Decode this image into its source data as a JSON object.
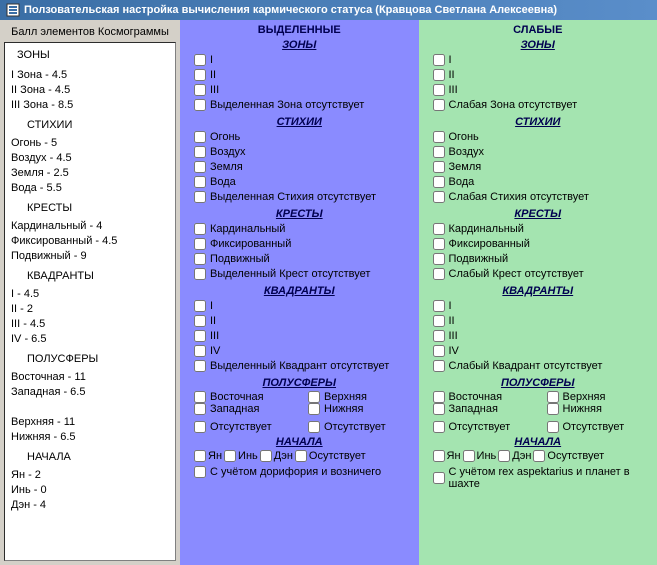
{
  "window": {
    "title": "Ползовательская настройка вычисления кармического статуса (Кравцова Светлана Алексеевна)"
  },
  "left": {
    "header": "Балл элементов Космограммы",
    "top_item": "ЗОНЫ",
    "groups": [
      {
        "title": "",
        "items": [
          "I Зона - 4.5",
          "II Зона - 4.5",
          "III Зона - 8.5"
        ]
      },
      {
        "title": "СТИХИИ",
        "items": [
          "Огонь - 5",
          "Воздух - 4.5",
          "Земля - 2.5",
          "Вода - 5.5"
        ]
      },
      {
        "title": "КРЕСТЫ",
        "items": [
          "Кардинальный - 4",
          "Фиксированный - 4.5",
          "Подвижный - 9"
        ]
      },
      {
        "title": "КВАДРАНТЫ",
        "items": [
          "I - 4.5",
          "II - 2",
          "III - 4.5",
          "IV - 6.5"
        ]
      },
      {
        "title": "ПОЛУСФЕРЫ",
        "items": [
          "Восточная - 11",
          "Западная - 6.5",
          "",
          "Верхняя - 11",
          "Нижняя - 6.5"
        ]
      },
      {
        "title": "НАЧАЛА",
        "items": [
          "Ян - 2",
          "Инь - 0",
          "Дэн - 4"
        ]
      }
    ]
  },
  "panes": {
    "highlighted": {
      "title": "ВЫДЕЛЕННЫЕ",
      "zones": {
        "head": "ЗОНЫ",
        "items": [
          "I",
          "II",
          "III"
        ],
        "absent": "Выделенная Зона отсутствует"
      },
      "elements": {
        "head": "СТИХИИ",
        "items": [
          "Огонь",
          "Воздух",
          "Земля",
          "Вода"
        ],
        "absent": "Выделенная Стихия отсутствует"
      },
      "crosses": {
        "head": "КРЕСТЫ",
        "items": [
          "Кардинальный",
          "Фиксированный",
          "Подвижный"
        ],
        "absent": "Выделенный Крест отсутствует"
      },
      "quadrants": {
        "head": "КВАДРАНТЫ",
        "items": [
          "I",
          "II",
          "III",
          "IV"
        ],
        "absent": "Выделенный Квадрант отсутствует"
      },
      "hemis": {
        "head": "ПОЛУСФЕРЫ",
        "east": "Восточная",
        "west": "Западная",
        "top": "Верхняя",
        "bot": "Нижняя",
        "abs1": "Отсутствует",
        "abs2": "Отсутствует"
      },
      "begin": {
        "head": "НАЧАЛА",
        "yan": "Ян",
        "in": "Инь",
        "den": "Дэн",
        "abs": "Осутствует"
      },
      "bottom": "С учётом дорифория и возничего"
    },
    "weak": {
      "title": "СЛАБЫЕ",
      "zones": {
        "head": "ЗОНЫ",
        "items": [
          "I",
          "II",
          "III"
        ],
        "absent": "Слабая Зона отсутствует"
      },
      "elements": {
        "head": "СТИХИИ",
        "items": [
          "Огонь",
          "Воздух",
          "Земля",
          "Вода"
        ],
        "absent": "Слабая Стихия отсутствует"
      },
      "crosses": {
        "head": "КРЕСТЫ",
        "items": [
          "Кардинальный",
          "Фиксированный",
          "Подвижный"
        ],
        "absent": "Слабый Крест отсутствует"
      },
      "quadrants": {
        "head": "КВАДРАНТЫ",
        "items": [
          "I",
          "II",
          "III",
          "IV"
        ],
        "absent": "Слабый Квадрант отсутствует"
      },
      "hemis": {
        "head": "ПОЛУСФЕРЫ",
        "east": "Восточная",
        "west": "Западная",
        "top": "Верхняя",
        "bot": "Нижняя",
        "abs1": "Отсутствует",
        "abs2": "Отсутствует"
      },
      "begin": {
        "head": "НАЧАЛА",
        "yan": "Ян",
        "in": "Инь",
        "den": "Дэн",
        "abs": "Осутствует"
      },
      "bottom": "С учётом rex aspektarius и планет в шахте"
    }
  }
}
